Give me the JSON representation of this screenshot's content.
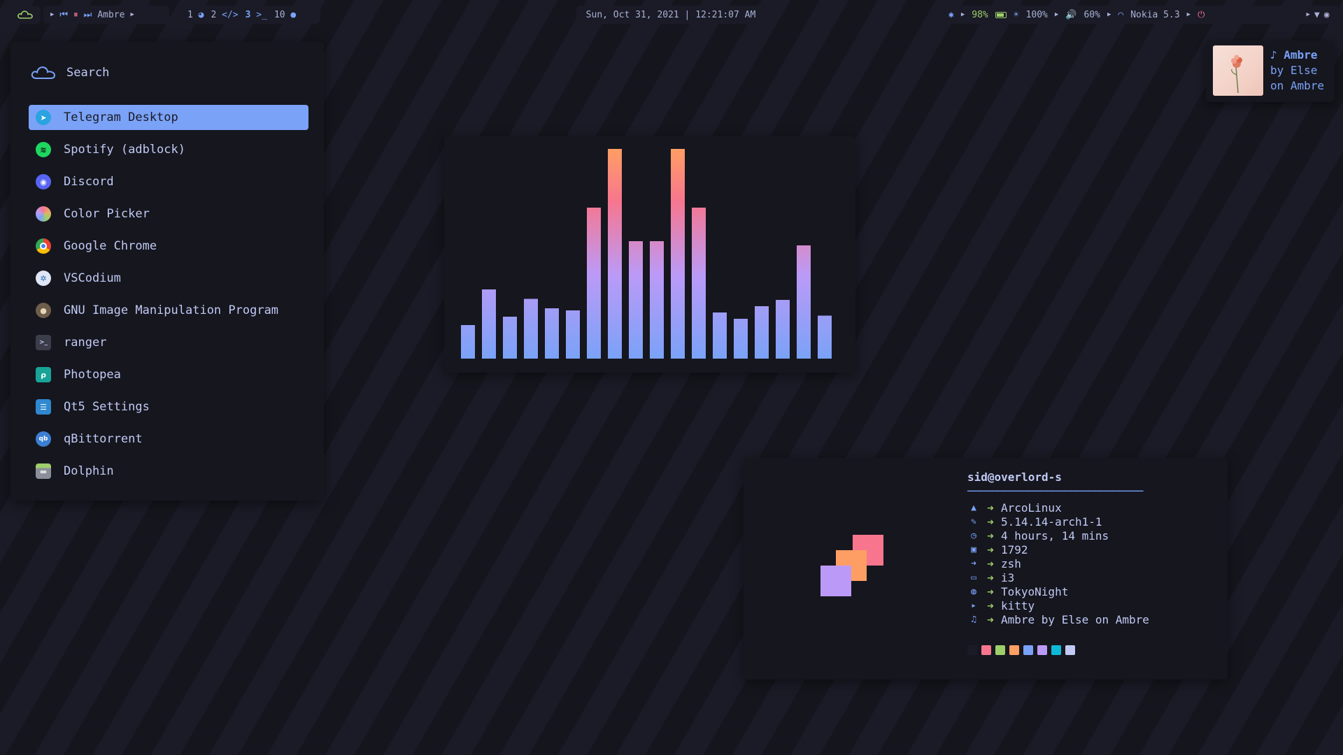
{
  "topbar": {
    "media": {
      "track": "Ambre"
    },
    "workspaces": [
      {
        "num": "1",
        "icon": "firefox-icon",
        "glyph": "◕"
      },
      {
        "num": "2",
        "icon": "code-icon",
        "glyph": "</>"
      },
      {
        "num": "3",
        "icon": "terminal-icon",
        "glyph": ">_"
      },
      {
        "num": "10",
        "icon": "discord-icon",
        "glyph": "●"
      }
    ],
    "datetime": "Sun, Oct 31, 2021 | 12:21:07 AM",
    "battery": "98%",
    "brightness": "100%",
    "volume": "60%",
    "network": "Nokia 5.3"
  },
  "launcher": {
    "search_label": "Search",
    "apps": [
      {
        "label": "Telegram Desktop",
        "icon": "telegram-icon",
        "glyph": "➤",
        "color": "#2aa3e0",
        "selected": true
      },
      {
        "label": "Spotify (adblock)",
        "icon": "spotify-icon",
        "glyph": "≋",
        "color": "#1ed760"
      },
      {
        "label": "Discord",
        "icon": "discord-icon",
        "glyph": "◉",
        "color": "#5865f2"
      },
      {
        "label": "Color Picker",
        "icon": "color-picker-icon",
        "glyph": "",
        "color": "#e0af68"
      },
      {
        "label": "Google Chrome",
        "icon": "chrome-icon",
        "glyph": "",
        "color": "#4285f4"
      },
      {
        "label": "VSCodium",
        "icon": "vscodium-icon",
        "glyph": "✲",
        "color": "#dfe6f5"
      },
      {
        "label": "GNU Image Manipulation Program",
        "icon": "gimp-icon",
        "glyph": "●",
        "color": "#6e5d4a"
      },
      {
        "label": "ranger",
        "icon": "ranger-icon",
        "glyph": ">_",
        "color": "#3b3d4a"
      },
      {
        "label": "Photopea",
        "icon": "photopea-icon",
        "glyph": "ρ",
        "color": "#18a497"
      },
      {
        "label": "Qt5 Settings",
        "icon": "qt5-settings-icon",
        "glyph": "☰",
        "color": "#2f88d0"
      },
      {
        "label": "qBittorrent",
        "icon": "qbittorrent-icon",
        "glyph": "qb",
        "color": "#3b7fd4"
      },
      {
        "label": "Dolphin",
        "icon": "dolphin-icon",
        "glyph": "▬",
        "color": "#8a8f99"
      }
    ]
  },
  "visualizer": {
    "levels": [
      0.16,
      0.33,
      0.2,
      0.285,
      0.24,
      0.23,
      0.72,
      1.0,
      0.56,
      0.56,
      1.0,
      0.72,
      0.22,
      0.19,
      0.25,
      0.28,
      0.54,
      0.205
    ],
    "colors": [
      "#7aa2f7",
      "#bb9af7",
      "#f7768e",
      "#ff9e64"
    ]
  },
  "nowplaying": {
    "title": "♪ Ambre",
    "artist": "by Else",
    "album": "on Ambre"
  },
  "fetch": {
    "user": "sid@overlord-s",
    "separator": "─────────────────────────────",
    "rows": [
      {
        "icon": "arch-icon",
        "glyph": "▲",
        "value": "ArcoLinux"
      },
      {
        "icon": "wrench-icon",
        "glyph": "✎",
        "value": "5.14.14-arch1-1"
      },
      {
        "icon": "clock-icon",
        "glyph": "◷",
        "value": "4 hours, 14 mins"
      },
      {
        "icon": "package-icon",
        "glyph": "▣",
        "value": "1792"
      },
      {
        "icon": "shell-icon",
        "glyph": "➜",
        "value": "zsh"
      },
      {
        "icon": "window-icon",
        "glyph": "▭",
        "value": "i3"
      },
      {
        "icon": "palette-icon",
        "glyph": "◍",
        "value": "TokyoNight"
      },
      {
        "icon": "terminal-icon",
        "glyph": "▸",
        "value": "kitty"
      },
      {
        "icon": "music-icon",
        "glyph": "♫",
        "value": "Ambre by Else on Ambre"
      }
    ],
    "arrow": "➜",
    "palette": [
      "#1a1b26",
      "#f7768e",
      "#9ece6a",
      "#ff9e64",
      "#7aa2f7",
      "#bb9af7",
      "#0db9d7",
      "#c0caf5"
    ],
    "logo_colors": [
      "#f7768e",
      "#ff9e64",
      "#bb9af7"
    ]
  }
}
